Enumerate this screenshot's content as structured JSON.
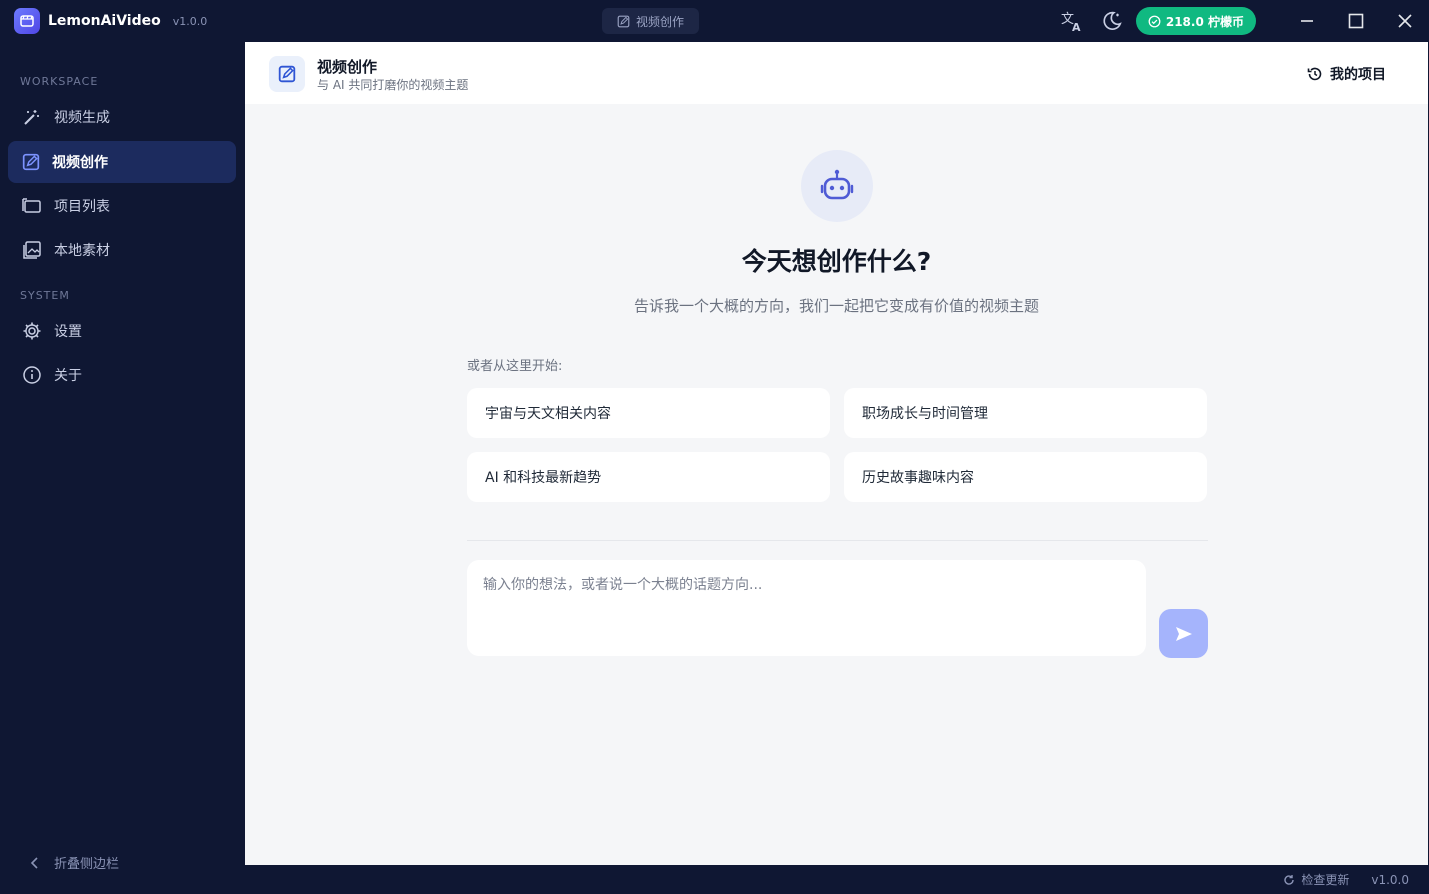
{
  "app": {
    "name": "LemonAiVideo",
    "version": "v1.0.0"
  },
  "titlebar": {
    "center_tab": "视频创作",
    "coins": "218.0 柠檬币"
  },
  "sidebar": {
    "workspace_label": "WORKSPACE",
    "system_label": "SYSTEM",
    "items": [
      {
        "label": "视频生成",
        "icon": "magic-wand-icon"
      },
      {
        "label": "视频创作",
        "icon": "edit-square-icon",
        "active": true
      },
      {
        "label": "项目列表",
        "icon": "folder-stack-icon"
      },
      {
        "label": "本地素材",
        "icon": "image-gallery-icon"
      }
    ],
    "system_items": [
      {
        "label": "设置",
        "icon": "gear-icon"
      },
      {
        "label": "关于",
        "icon": "info-icon"
      }
    ],
    "collapse_label": "折叠侧边栏"
  },
  "header": {
    "title": "视频创作",
    "subtitle": "与 AI 共同打磨你的视频主题",
    "my_projects": "我的项目"
  },
  "hero": {
    "title": "今天想创作什么?",
    "subtitle": "告诉我一个大概的方向，我们一起把它变成有价值的视频主题"
  },
  "suggestions": {
    "label": "或者从这里开始:",
    "items": [
      "宇宙与天文相关内容",
      "职场成长与时间管理",
      "AI 和科技最新趋势",
      "历史故事趣味内容"
    ]
  },
  "prompt": {
    "placeholder": "输入你的想法，或者说一个大概的话题方向..."
  },
  "status": {
    "check_update": "检查更新",
    "version": "v1.0.0"
  },
  "colors": {
    "accent": "#4f5bd5",
    "coins": "#10b981",
    "sidebar_bg": "#0f1733",
    "active_item": "#1c2b5e",
    "send": "#a5b4fc"
  }
}
